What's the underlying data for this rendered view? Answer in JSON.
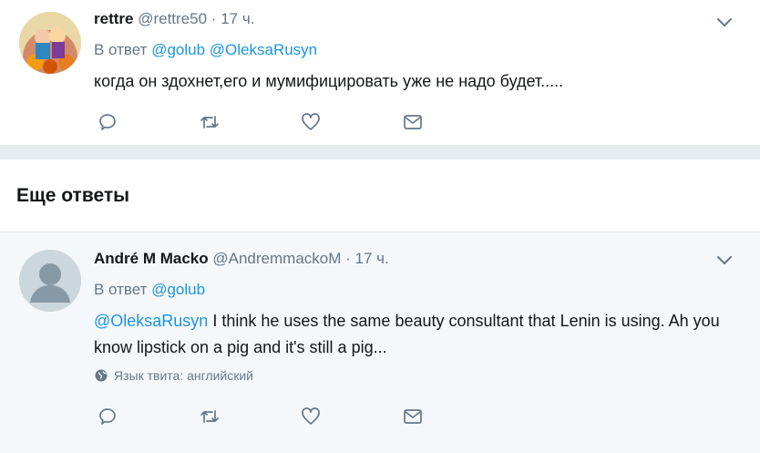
{
  "tweets": [
    {
      "name": "rettre",
      "handle": "@rettre50",
      "dot": "·",
      "time": "17 ч.",
      "reply_prefix": "В ответ",
      "reply_users": [
        "@golub",
        "@OleksaRusyn"
      ],
      "text": "когда он здохнет,его и мумифицировать уже не надо будет....."
    },
    {
      "name": "André M Macko",
      "handle": "@AndremmackoM",
      "dot": "·",
      "time": "17 ч.",
      "reply_prefix": "В ответ",
      "reply_users": [
        "@golub"
      ],
      "mention": "@OleksaRusyn",
      "text": " I think he uses the same beauty consultant that  Lenin is using. Ah you know lipstick on a pig and it's still a pig...",
      "language_note": "Язык твита: английский"
    }
  ],
  "section": {
    "title": "Еще ответы"
  },
  "icons": {
    "reply": "speech-bubble-icon",
    "retweet": "retweet-arrows-icon",
    "like": "heart-outline-icon",
    "dm": "envelope-icon",
    "more": "chevron-down-icon",
    "globe": "globe-icon"
  },
  "colors": {
    "link": "#1b95e0",
    "muted": "#657786",
    "text": "#14171a",
    "background": "#e6ecf0",
    "highlight_row": "#f5f8fa"
  }
}
